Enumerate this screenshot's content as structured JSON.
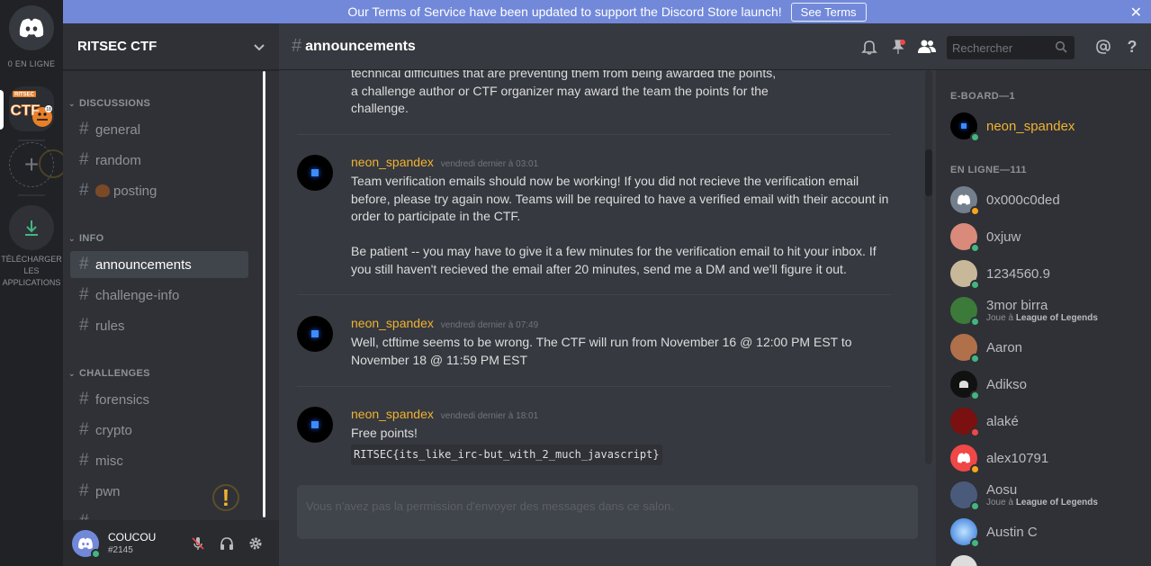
{
  "notice": {
    "text": "Our Terms of Service have been updated to support the Discord Store launch!",
    "button": "See Terms"
  },
  "rail": {
    "online_count": "0 EN LIGNE",
    "download_label": "TÉLÉCHARGER LES APPLICATIONS"
  },
  "guild": {
    "name": "RITSEC CTF",
    "server_icon_text": "CTF",
    "server_icon_tag": "RITSEC",
    "server_icon_year": "18"
  },
  "sidebar": {
    "categories": [
      {
        "label": "DISCUSSIONS"
      },
      {
        "label": "INFO"
      },
      {
        "label": "CHALLENGES"
      }
    ],
    "channels": [
      {
        "label": "general"
      },
      {
        "label": "random"
      },
      {
        "label": "posting"
      },
      {
        "label": "announcements"
      },
      {
        "label": "challenge-info"
      },
      {
        "label": "rules"
      },
      {
        "label": "forensics"
      },
      {
        "label": "crypto"
      },
      {
        "label": "misc"
      },
      {
        "label": "pwn"
      }
    ]
  },
  "user": {
    "name": "COUCOU",
    "tag": "#2145"
  },
  "chat": {
    "channel": "announcements",
    "search_placeholder": "Rechercher",
    "composer_placeholder": "Vous n'avez pas la permission d'envoyer des messages dans ce salon.",
    "partial": [
      "technical difficulties that are preventing them from being awarded the points,",
      "a challenge author or CTF organizer may award the team the points for the",
      "challenge."
    ],
    "messages": [
      {
        "author": "neon_spandex",
        "time": "vendredi dernier à 03:01",
        "lines": [
          "Team verification emails should now be working! If you did not recieve the verification email",
          "before, please try again now. Teams will be required to have a verified email with their account in",
          "order to participate in the CTF."
        ],
        "lines2": [
          "Be patient -- you may have to give it a few minutes for the verification email to hit your inbox. If",
          "you still haven't recieved the email after 20 minutes, send me a DM and we'll figure it out."
        ]
      },
      {
        "author": "neon_spandex",
        "time": "vendredi dernier à 07:49",
        "lines": [
          "Well, ctftime seems to be wrong. The CTF will run from November 16 @ 12:00 PM EST to",
          "November 18 @ 11:59 PM EST"
        ]
      },
      {
        "author": "neon_spandex",
        "time": "vendredi dernier à 18:01",
        "lines": [
          "Free points!"
        ],
        "code": "RITSEC{its_like_irc-but_with_2_much_javascript}"
      }
    ]
  },
  "members": {
    "groups": [
      {
        "label": "E-BOARD—1"
      },
      {
        "label": "EN LIGNE—111"
      }
    ],
    "list": [
      {
        "name": "neon_spandex",
        "status": "online"
      },
      {
        "name": "0x000c0ded",
        "status": "idle"
      },
      {
        "name": "0xjuw",
        "status": "online"
      },
      {
        "name": "1234560.9",
        "status": "online"
      },
      {
        "name": "3mor birra",
        "status": "online",
        "activity_prefix": "Joue à",
        "activity_game": "League of Legends"
      },
      {
        "name": "Aaron",
        "status": "online"
      },
      {
        "name": "Adikso",
        "status": "online"
      },
      {
        "name": "alaké",
        "status": "dnd"
      },
      {
        "name": "alex10791",
        "status": "idle"
      },
      {
        "name": "Aosu",
        "status": "online",
        "activity_prefix": "Joue à",
        "activity_game": "League of Legends"
      },
      {
        "name": "Austin C",
        "status": "online"
      }
    ]
  },
  "colors": {
    "blurple": "#7289da",
    "online": "#43b581",
    "idle": "#faa61a",
    "dnd": "#f04747",
    "gold": "#f0b232"
  }
}
